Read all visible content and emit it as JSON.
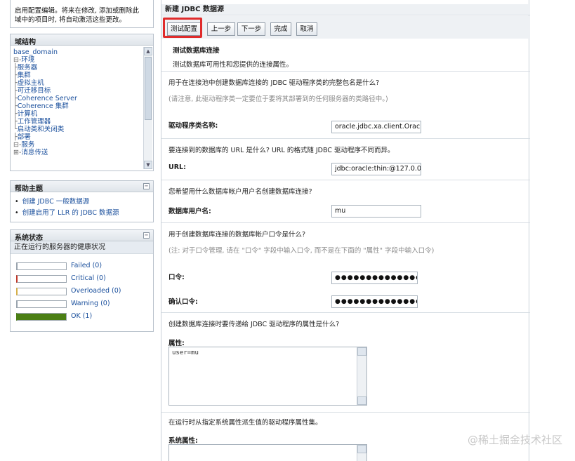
{
  "info_panel": {
    "line1": "启用配置编辑。将来在修改, 添加或删除此",
    "line2": "域中的项目时, 将自动激活这些更改。"
  },
  "domain_tree": {
    "title": "域结构",
    "items": [
      {
        "prefix": "",
        "label": "base_domain"
      },
      {
        "prefix": "⊟-",
        "label": "环境"
      },
      {
        "prefix": "    ├",
        "label": "服务器"
      },
      {
        "prefix": "    ├",
        "label": "集群"
      },
      {
        "prefix": "    ├",
        "label": "虚拟主机"
      },
      {
        "prefix": "    ├",
        "label": "可迁移目标"
      },
      {
        "prefix": "    ├",
        "label": "Coherence Server"
      },
      {
        "prefix": "    ├",
        "label": "Coherence 集群"
      },
      {
        "prefix": "    ├",
        "label": "计算机"
      },
      {
        "prefix": "    ├",
        "label": "工作管理器"
      },
      {
        "prefix": "    └",
        "label": "启动类和关闭类"
      },
      {
        "prefix": "├",
        "label": "部署"
      },
      {
        "prefix": "⊟-",
        "label": "服务"
      },
      {
        "prefix": "    ⊞-",
        "label": "消息传送"
      }
    ]
  },
  "help": {
    "title": "帮助主题",
    "links": [
      "创建 JDBC 一般数据源",
      "创建启用了 LLR 的 JDBC 数据源"
    ]
  },
  "system_status": {
    "title": "系统状态",
    "subtitle": "正在运行的服务器的健康状况",
    "rows": [
      {
        "label": "Failed (0)",
        "color": "#9aa4ae",
        "fill": 0
      },
      {
        "label": "Critical (0)",
        "color": "#c0392b",
        "fill": 0
      },
      {
        "label": "Overloaded (0)",
        "color": "#d6b04a",
        "fill": 0
      },
      {
        "label": "Warning (0)",
        "color": "#9aa4ae",
        "fill": 0
      },
      {
        "label": "OK (1)",
        "color": "#4b7f14",
        "fill": 1
      }
    ]
  },
  "form": {
    "title": "新建 JDBC 数据源",
    "buttons": {
      "test": "测试配置",
      "back": "上一步",
      "next": "下一步",
      "finish": "完成",
      "cancel": "取消"
    },
    "test_section": {
      "heading": "测试数据库连接",
      "desc": "测试数据库可用性和您提供的连接属性。"
    },
    "driver": {
      "question": "用于在连接池中创建数据库连接的 JDBC 驱动程序类的完整包名是什么?",
      "hint": "(请注意, 此驱动程序类一定要位于要将其部署到的任何服务器的类路径中。)",
      "label": "驱动程序类名称:",
      "value": "oracle.jdbc.xa.client.Oracl"
    },
    "url": {
      "question": "要连接到的数据库的 URL 是什么? URL 的格式随 JDBC 驱动程序不同而异。",
      "label": "URL:",
      "value": "jdbc:oracle:thin:@127.0.0."
    },
    "user": {
      "question": "您希望用什么数据库帐户用户名创建数据库连接?",
      "label": "数据库用户名:",
      "value": "mu"
    },
    "password": {
      "question": "用于创建数据库连接的数据库帐户口令是什么?",
      "hint": "(注: 对于口令管理, 请在 \"口令\" 字段中输入口令, 而不是在下面的 \"属性\" 字段中输入口令)",
      "label": "口令:",
      "value": "●●●●●●●●●●●●●●●●●●●●●●",
      "confirm_label": "确认口令:",
      "confirm_value": "●●●●●●●●●●●●●●●●●●●●●●"
    },
    "properties": {
      "question": "创建数据库连接时要传递给 JDBC 驱动程序的属性是什么?",
      "label": "属性:",
      "value": "user=mu"
    },
    "sys_properties": {
      "question": "在运行时从指定系统属性派生值的驱动程序属性集。",
      "label": "系统属性:"
    }
  },
  "watermark": "@稀土掘金技术社区"
}
